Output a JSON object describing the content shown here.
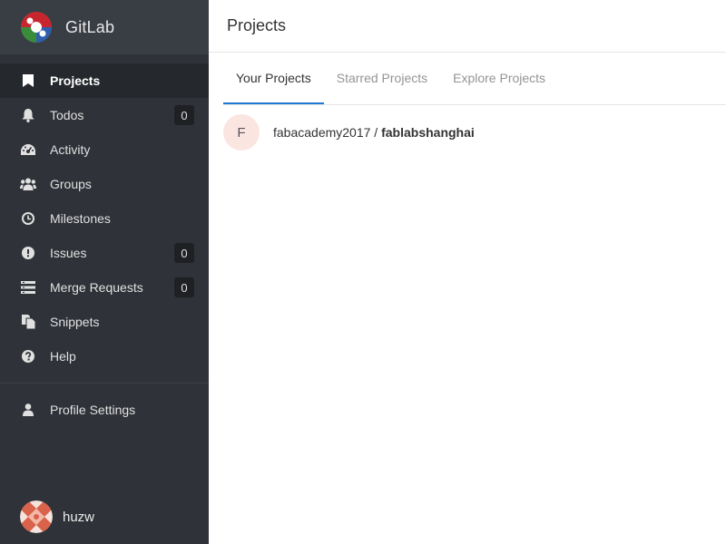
{
  "app": {
    "title": "GitLab"
  },
  "sidebar": {
    "items": [
      {
        "label": "Projects",
        "icon": "bookmark-icon",
        "active": true
      },
      {
        "label": "Todos",
        "icon": "bell-icon",
        "badge": "0"
      },
      {
        "label": "Activity",
        "icon": "dashboard-icon"
      },
      {
        "label": "Groups",
        "icon": "users-icon"
      },
      {
        "label": "Milestones",
        "icon": "clock-icon"
      },
      {
        "label": "Issues",
        "icon": "exclamation-circle-icon",
        "badge": "0"
      },
      {
        "label": "Merge Requests",
        "icon": "list-icon",
        "badge": "0"
      },
      {
        "label": "Snippets",
        "icon": "files-icon"
      },
      {
        "label": "Help",
        "icon": "question-circle-icon"
      }
    ],
    "profile": {
      "label": "Profile Settings",
      "icon": "user-icon"
    }
  },
  "user": {
    "name": "huzw"
  },
  "main": {
    "title": "Projects",
    "tabs": [
      {
        "label": "Your Projects",
        "active": true
      },
      {
        "label": "Starred Projects"
      },
      {
        "label": "Explore Projects"
      }
    ],
    "projects": [
      {
        "avatar_letter": "F",
        "namespace": "fabacademy2017 / ",
        "name": "fablabshanghai"
      }
    ]
  },
  "colors": {
    "sidebar_bg": "#2f3238",
    "sidebar_header_bg": "#393d44",
    "sidebar_active_bg": "#25282d",
    "tab_active_border": "#1f78d1",
    "project_avatar_bg": "#fbe5e1"
  }
}
